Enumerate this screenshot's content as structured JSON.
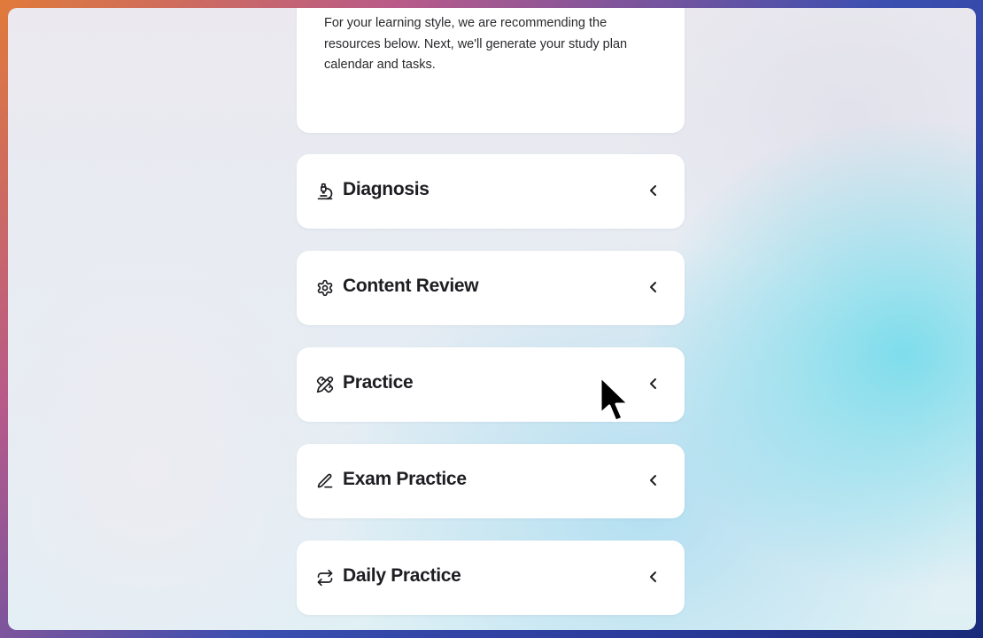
{
  "intro": {
    "text": "For your learning style, we are recommending the resources below. Next, we'll generate your study plan calendar and tasks."
  },
  "sections": [
    {
      "title": "Diagnosis",
      "icon": "microscope-icon"
    },
    {
      "title": "Content Review",
      "icon": "gear-icon"
    },
    {
      "title": "Practice",
      "icon": "pencil-ruler-icon"
    },
    {
      "title": "Exam Practice",
      "icon": "pencil-icon"
    },
    {
      "title": "Daily Practice",
      "icon": "repeat-icon"
    }
  ],
  "chevron_icon": "chevron-left-icon",
  "cursor_icon": "mouse-pointer-icon"
}
